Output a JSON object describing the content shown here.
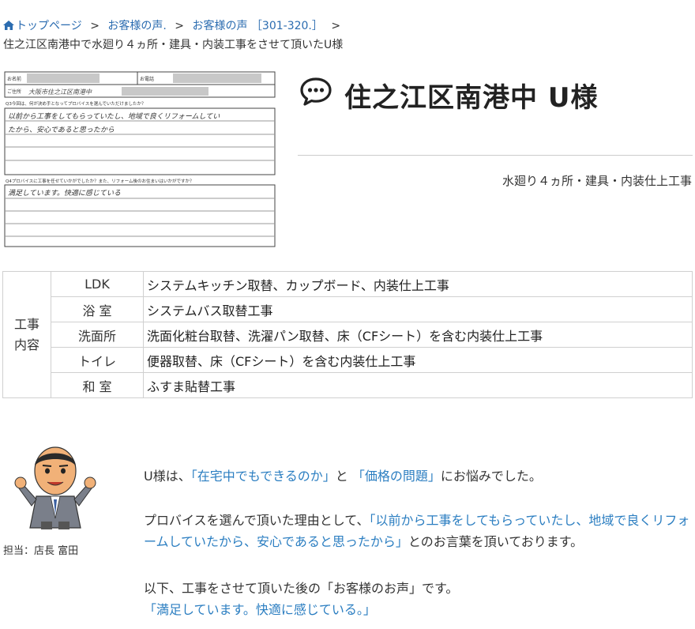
{
  "breadcrumb": {
    "items": [
      "トップページ",
      "お客様の声.",
      "お客様の声 ［301-320.］"
    ],
    "separator": ">"
  },
  "page_subtitle": "住之江区南港中で水廻り４ヵ所・建具・内装工事をさせて頂いたU様",
  "scan": {
    "name_label": "お名前",
    "phone_label": "お電話",
    "address_label": "ご住所",
    "address_handwriting": "大阪市住之江区南港中",
    "q3": "Q3今回は、何が決め手となってプロバイスを選んでいただけましたか？",
    "q3_answer_line1": "以前から工事をしてもらっていたし、地域で良くリフォームしてい",
    "q3_answer_line2": "たから、安心であると思ったから",
    "q4": "Q4プロバイスに工事を任せていかがでしたか？また、リフォーム後のお住まいはいかがですか？",
    "q4_answer": "満足しています。快適に感じている"
  },
  "title": "住之江区南港中 U様",
  "work_summary": "水廻り４ヵ所・建具・内装仕上工事",
  "works_table": {
    "category_line1": "工事",
    "category_line2": "内容",
    "rows": [
      {
        "room": "LDK",
        "desc": "システムキッチン取替、カップボード、内装仕上工事"
      },
      {
        "room": "浴 室",
        "desc": "システムバス取替工事"
      },
      {
        "room": "洗面所",
        "desc": "洗面化粧台取替、洗濯パン取替、床（CFシート）を含む内装仕上工事"
      },
      {
        "room": "トイレ",
        "desc": "便器取替、床（CFシート）を含む内装仕上工事"
      },
      {
        "room": "和 室",
        "desc": "ふすま貼替工事"
      }
    ]
  },
  "staff_caption": "担当：店長 富田",
  "message": {
    "p1_pre": "U様は、",
    "p1_q1": "「在宅中でもできるのか」",
    "p1_mid": "と",
    "p1_q2": "「価格の問題」",
    "p1_post": "にお悩みでした。",
    "p2_pre": "プロバイスを選んで頂いた理由として、",
    "p2_quote": "「以前から工事をしてもらっていたし、地域で良くリフォームしていたから、安心であると思ったから」",
    "p2_post": "とのお言葉を頂いております。",
    "p3_line1": "以下、工事をさせて頂いた後の「お客様のお声」です。",
    "p3_quote": "「満足しています。快適に感じている。」"
  },
  "colors": {
    "link": "#2b6cb0",
    "highlight": "#2b7ec1",
    "border": "#d0d0d0"
  }
}
